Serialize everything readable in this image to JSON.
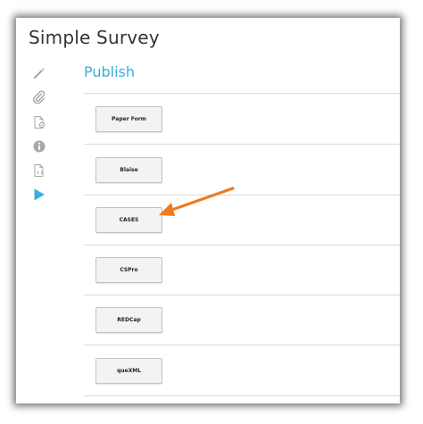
{
  "app": {
    "title": "Simple Survey"
  },
  "sidebar": {
    "items": [
      {
        "name": "edit-icon",
        "color": "#a8a8a8"
      },
      {
        "name": "attachment-icon",
        "color": "#a8a8a8"
      },
      {
        "name": "document-settings-icon",
        "color": "#a8a8a8"
      },
      {
        "name": "info-icon",
        "color": "#a8a8a8"
      },
      {
        "name": "document-code-icon",
        "color": "#a8a8a8"
      },
      {
        "name": "publish-play-icon",
        "color": "#3aaed8",
        "active": true
      }
    ]
  },
  "main": {
    "section_title": "Publish",
    "buttons": [
      {
        "label": "Paper Form"
      },
      {
        "label": "Blaise"
      },
      {
        "label": "CASES"
      },
      {
        "label": "CSPro"
      },
      {
        "label": "REDCap"
      },
      {
        "label": "queXML"
      }
    ]
  },
  "annotation": {
    "arrow_icon": "arrow-left-icon",
    "arrow_color": "#f07a20"
  },
  "colors": {
    "accent": "#3aaed8",
    "icon_gray": "#a8a8a8",
    "annotation_orange": "#f07a20"
  }
}
